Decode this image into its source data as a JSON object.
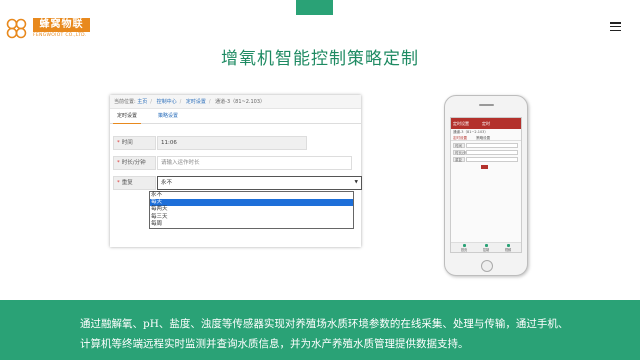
{
  "brand": {
    "name": "蜂窝物联",
    "subtitle": "FENGWOIOT CO.,LTD.",
    "color": "#e8891d"
  },
  "accent_color": "#2aa276",
  "title": "增氧机智能控制策略定制",
  "screenshot": {
    "breadcrumb": {
      "prefix": "当前位置:",
      "items": [
        "主页",
        "控制中心",
        "定时设置",
        "通道-3（81~2.103）"
      ]
    },
    "tabs": [
      "定时设置",
      "策略设置"
    ],
    "fields": {
      "time": {
        "label": "时间",
        "value": "11:06"
      },
      "duration": {
        "label": "时长/分钟",
        "placeholder": "请输入运作时长"
      },
      "repeat": {
        "label": "重复",
        "value": "永不"
      }
    },
    "dropdown_options": [
      "永不",
      "每天",
      "每两天",
      "每三天",
      "每周"
    ],
    "dropdown_selected": "每天"
  },
  "phone": {
    "header_title": "定时",
    "header_left": "定时设置",
    "crumb": "通道-3（81~2.103）",
    "tabs": [
      "定时设置",
      "策略设置"
    ],
    "rows": [
      "时间",
      "时长/分钟",
      "重复"
    ],
    "footer_items": [
      "首页",
      "控制",
      "视频"
    ]
  },
  "footer": {
    "text_line1": "通过融解氧、pH、盐度、浊度等传感器实现对养殖场水质环境参数的在线采集、处理与传输，通过手机、",
    "text_line2": "计算机等终端远程实时监测并查询水质信息，并为水产养殖水质管理提供数据支持。"
  }
}
